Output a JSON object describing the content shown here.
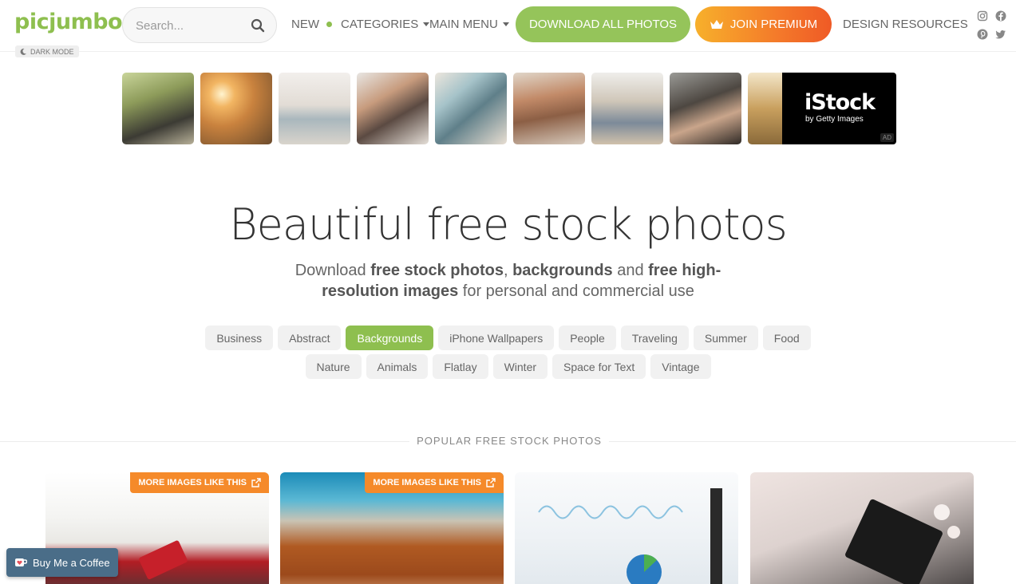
{
  "header": {
    "logo": "picjumbo",
    "dark_mode_label": "DARK MODE",
    "search_placeholder": "Search...",
    "nav": {
      "new": "NEW",
      "categories": "CATEGORIES",
      "main_menu": "MAIN MENU",
      "design_resources": "DESIGN RESOURCES"
    },
    "download_all": "DOWNLOAD ALL PHOTOS",
    "join_premium": "JOIN PREMIUM",
    "social_icons": [
      "instagram-icon",
      "facebook-icon",
      "pinterest-icon",
      "twitter-icon"
    ]
  },
  "ad": {
    "logo": "iStock",
    "sub": "by Getty Images",
    "tag": "AD"
  },
  "hero": {
    "title": "Beautiful free stock photos",
    "sub_1": "Download ",
    "sub_b1": "free stock photos",
    "sub_2": ", ",
    "sub_b2": "backgrounds",
    "sub_3": " and ",
    "sub_b3": "free high-resolution images",
    "sub_4": " for personal and commercial use"
  },
  "tags_row1": [
    "Business",
    "Abstract",
    "Backgrounds",
    "iPhone Wallpapers",
    "People",
    "Traveling",
    "Summer",
    "Food"
  ],
  "tags_row2": [
    "Nature",
    "Animals",
    "Flatlay",
    "Winter",
    "Space for Text",
    "Vintage"
  ],
  "active_tag": "Backgrounds",
  "section_title": "POPULAR FREE STOCK PHOTOS",
  "more_images_label": "MORE IMAGES LIKE THIS",
  "buy_coffee": "Buy Me a Coffee",
  "colors": {
    "brand_green": "#8ebf4f",
    "premium_orange": "#f47a2a"
  }
}
